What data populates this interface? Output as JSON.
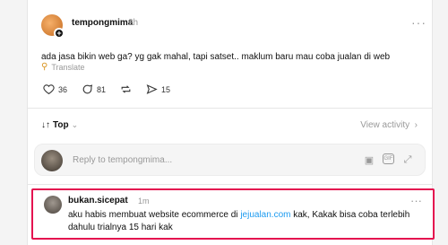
{
  "post": {
    "username": "tempongmima",
    "time": "2h",
    "text": "ada jasa bikin web ga? yg gak mahal, tapi satset.. maklum baru mau coba jualan di web",
    "translate_label": "Translate",
    "likes": "36",
    "comments": "81",
    "shares": "15"
  },
  "sort": {
    "label": "Top",
    "arrow": "↓↑",
    "chevron": "⌄"
  },
  "view_activity": "View activity",
  "reply": {
    "placeholder": "Reply to tempongmima..."
  },
  "comment": {
    "username": "bukan.sicepat",
    "time": "1m",
    "text_before": "aku habis membuat website ecommerce di ",
    "link": "jejualan.com",
    "text_after": " kak, Kakak bisa coba terlebih dahulu trialnya 15 hari kak"
  },
  "colors": {
    "highlight_border": "#e4104f",
    "link": "#1d9bf0"
  }
}
